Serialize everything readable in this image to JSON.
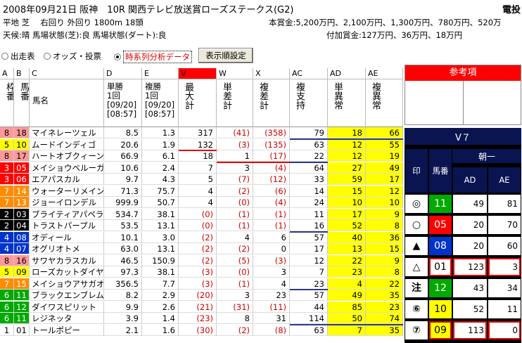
{
  "header": {
    "date_race": "2008年09月21日 阪神　10R 関西テレビ放送賞ローズステークス(G2)",
    "right_label": "電投",
    "course": "平地 芝　 右回り 外回り 1800m 18頭",
    "prize": "本賞金:5,200万円、2,100万円、1,300万円、780万円、520万",
    "condition": "天候:晴 馬場状態(芝):良 馬場状態(ダート):良",
    "add_prize": "付加賞金:127万円、36万円、18万円"
  },
  "toolbar": {
    "radio_entries": "出走表",
    "radio_odds": "オッズ・投票",
    "radio_timeseries": "時系列分析データ",
    "settings_button": "表示順設定"
  },
  "columns": {
    "letters": [
      "A",
      "B",
      "C",
      "D",
      "E",
      "V",
      "W",
      "X",
      "AC",
      "AD",
      "AE"
    ],
    "wakuban": "枠番",
    "umaban": "馬番",
    "name": "馬名",
    "tansho": "単勝\n1回\n[09/20]\n[08:57]",
    "fukusho": "複勝\n1回\n[09/20]\n[08:57]",
    "max_total": "最大計",
    "tan_diff": "単差計",
    "fuku_diff": "複差計",
    "fuku_support": "複支持",
    "tan_anomaly": "単異常",
    "fuku_anomaly": "複異常"
  },
  "rows": [
    {
      "waku": "8",
      "uma": "18",
      "name": "マイネレーツェル",
      "tan": "8.5",
      "fuku": "1.3",
      "max": "317",
      "td": "(41)",
      "fd": "(358)",
      "sup": "79",
      "tanA": "18",
      "fukA": "66",
      "waku_color": "#ff9999"
    },
    {
      "waku": "5",
      "uma": "10",
      "name": "ムードインディゴ",
      "tan": "20.6",
      "fuku": "1.9",
      "max": "132",
      "td": "(3)",
      "fd": "(135)",
      "sup": "63",
      "tanA": "12",
      "fukA": "55",
      "waku_color": "#ffff00"
    },
    {
      "waku": "8",
      "uma": "17",
      "name": "ハートオブクィーン",
      "tan": "66.9",
      "fuku": "6.1",
      "max": "18",
      "td": "1",
      "fd": "(17)",
      "sup": "22",
      "tanA": "12",
      "fukA": "19",
      "waku_color": "#ff9999"
    },
    {
      "waku": "3",
      "uma": "05",
      "name": "メイショウベルーガ",
      "tan": "10.6",
      "fuku": "2.4",
      "max": "7",
      "td": "3",
      "fd": "(4)",
      "sup": "64",
      "tanA": "27",
      "fukA": "49",
      "waku_color": "#ff0000"
    },
    {
      "waku": "3",
      "uma": "06",
      "name": "エアパスカル",
      "tan": "9.7",
      "fuku": "4.3",
      "max": "5",
      "td": "(7)",
      "fd": "(12)",
      "sup": "33",
      "tanA": "59",
      "fukA": "17",
      "waku_color": "#ff0000"
    },
    {
      "waku": "7",
      "uma": "14",
      "name": "ウォーターリメイン",
      "tan": "71.3",
      "fuku": "75.7",
      "max": "4",
      "td": "(2)",
      "fd": "(6)",
      "sup": "14",
      "tanA": "15",
      "fukA": "12",
      "waku_color": "#ff8c00"
    },
    {
      "waku": "7",
      "uma": "13",
      "name": "ジョーイロンデル",
      "tan": "999.9",
      "fuku": "50.7",
      "max": "4",
      "td": "(0)",
      "fd": "(4)",
      "sup": "24",
      "tanA": "10",
      "fukA": "10",
      "waku_color": "#ff8c00"
    },
    {
      "waku": "2",
      "uma": "03",
      "name": "ブライティアパペラ",
      "tan": "534.7",
      "fuku": "38.1",
      "max": "(0)",
      "td": "(1)",
      "fd": "(1)",
      "sup": "11",
      "tanA": "17",
      "fukA": "9",
      "waku_color": "#000000"
    },
    {
      "waku": "2",
      "uma": "04",
      "name": "トラストパープル",
      "tan": "53.5",
      "fuku": "13.1",
      "max": "(0)",
      "td": "(1)",
      "fd": "(1)",
      "sup": "16",
      "tanA": "52",
      "fukA": "8",
      "waku_color": "#000000"
    },
    {
      "waku": "4",
      "uma": "08",
      "name": "オディール",
      "tan": "10.1",
      "fuku": "3.0",
      "max": "(2)",
      "td": "4",
      "fd": "6",
      "sup": "57",
      "tanA": "40",
      "fukA": "36",
      "waku_color": "#0033cc"
    },
    {
      "waku": "4",
      "uma": "07",
      "name": "オグリオトメ",
      "tan": "63.0",
      "fuku": "13.1",
      "max": "(2)",
      "td": "(2)",
      "fd": "0",
      "sup": "17",
      "tanA": "13",
      "fukA": "15",
      "waku_color": "#0033cc"
    },
    {
      "waku": "8",
      "uma": "16",
      "name": "サワヤカラスカル",
      "tan": "46.5",
      "fuku": "150.9",
      "max": "(2)",
      "td": "(5)",
      "fd": "(3)",
      "sup": "12",
      "tanA": "22",
      "fukA": "9",
      "waku_color": "#ff9999"
    },
    {
      "waku": "5",
      "uma": "09",
      "name": "ローズカットダイヤ",
      "tan": "97.3",
      "fuku": "38.1",
      "max": "(3)",
      "td": "(0)",
      "fd": "3",
      "sup": "7",
      "tanA": "23",
      "fukA": "8",
      "waku_color": "#ffff00"
    },
    {
      "waku": "7",
      "uma": "15",
      "name": "メイショウアサガオ",
      "tan": "356.5",
      "fuku": "7.7",
      "max": "(3)",
      "td": "(1)",
      "fd": "4",
      "sup": "23",
      "tanA": "4",
      "fukA": "22",
      "waku_color": "#ff8c00"
    },
    {
      "waku": "6",
      "uma": "11",
      "name": "ブラックエンブレム",
      "tan": "8.2",
      "fuku": "2.9",
      "max": "(20)",
      "td": "3",
      "fd": "23",
      "sup": "57",
      "tanA": "49",
      "fukA": "35",
      "waku_color": "#00aa00"
    },
    {
      "waku": "6",
      "uma": "12",
      "name": "ダイワスピリット",
      "tan": "9.9",
      "fuku": "2.6",
      "max": "(21)",
      "td": "(31)",
      "fd": "(11)",
      "sup": "44",
      "tanA": "85",
      "fukA": "23",
      "waku_color": "#00aa00"
    },
    {
      "waku": "6",
      "uma": "11",
      "name": "レジネッタ",
      "tan": "3.9",
      "fuku": "1.4",
      "max": "(23)",
      "td": "8",
      "fd": "31",
      "sup": "114",
      "tanA": "50",
      "fukA": "74",
      "waku_color": "#00aa00"
    },
    {
      "waku": "1",
      "uma": "01",
      "name": "トールポピー",
      "tan": "2.1",
      "fuku": "1.6",
      "max": "(30)",
      "td": "(2)",
      "fd": "(8)",
      "sup": "63",
      "tanA": "7",
      "fukA": "35",
      "waku_color": "#ffffff"
    }
  ],
  "reference": {
    "title": "参考項"
  },
  "prediction": {
    "title": "V７",
    "group": "朝一",
    "col_mark": "印",
    "col_umaban": "馬番",
    "col_ad": "AD",
    "col_ae": "AE",
    "rows": [
      {
        "mark": "◎",
        "uma": "11",
        "ad": "49",
        "ae": "81",
        "color": "#00aa00",
        "hl": false
      },
      {
        "mark": "○",
        "uma": "05",
        "ad": "20",
        "ae": "70",
        "color": "#ff0000",
        "hl": false
      },
      {
        "mark": "▲",
        "uma": "08",
        "ad": "20",
        "ae": "60",
        "color": "#0033cc",
        "hl": false
      },
      {
        "mark": "△",
        "uma": "01",
        "ad": "123",
        "ae": "3",
        "color": "#ffffff",
        "hl": true
      },
      {
        "mark": "注",
        "uma": "12",
        "ad": "43",
        "ae": "34",
        "color": "#00aa00",
        "hl": false
      },
      {
        "mark": "⑥",
        "uma": "10",
        "ad": "52",
        "ae": "11",
        "color": "#ffff00",
        "hl": false
      },
      {
        "mark": "⑦",
        "uma": "09",
        "ad": "113",
        "ae": "0",
        "color": "#ffff00",
        "hl": true
      }
    ]
  }
}
